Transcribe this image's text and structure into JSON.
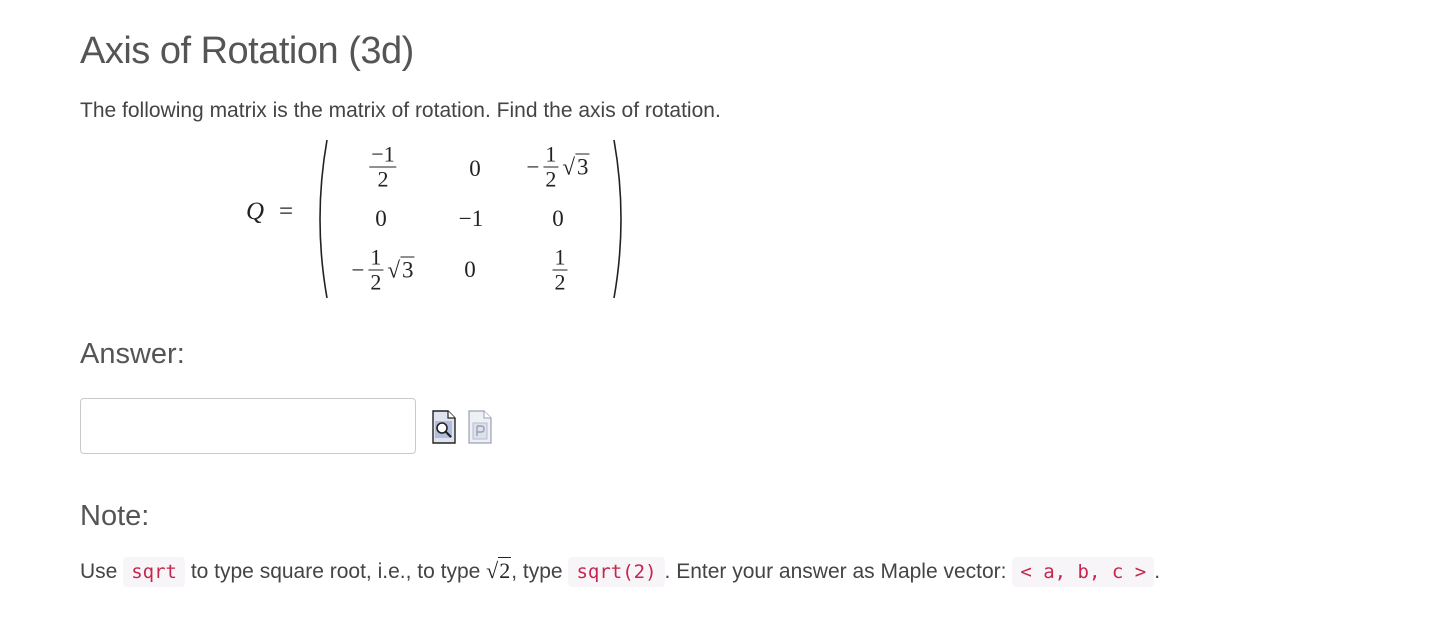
{
  "page": {
    "title": "Axis of Rotation (3d)",
    "question": "The following matrix is the matrix of rotation. Find the axis of rotation."
  },
  "matrix": {
    "label": "Q",
    "equals": "=",
    "one": "1",
    "two": "2",
    "three": "3",
    "neg_one": "−1",
    "zero": "0",
    "minus": "−"
  },
  "answer": {
    "label": "Answer:",
    "input_value": "",
    "preview_icon": "preview-icon",
    "paste_icon": "paste-icon"
  },
  "note": {
    "label": "Note:",
    "part1": "Use",
    "code1": "sqrt",
    "part2": "to type square root, i.e., to type",
    "inline_num": "2",
    "part3": ", type",
    "code2": "sqrt(2)",
    "part4": ". Enter your answer as Maple vector:",
    "code3": "< a, b, c >",
    "part5": "."
  },
  "colors": {
    "code": "#c7254e",
    "heading": "#555555"
  }
}
